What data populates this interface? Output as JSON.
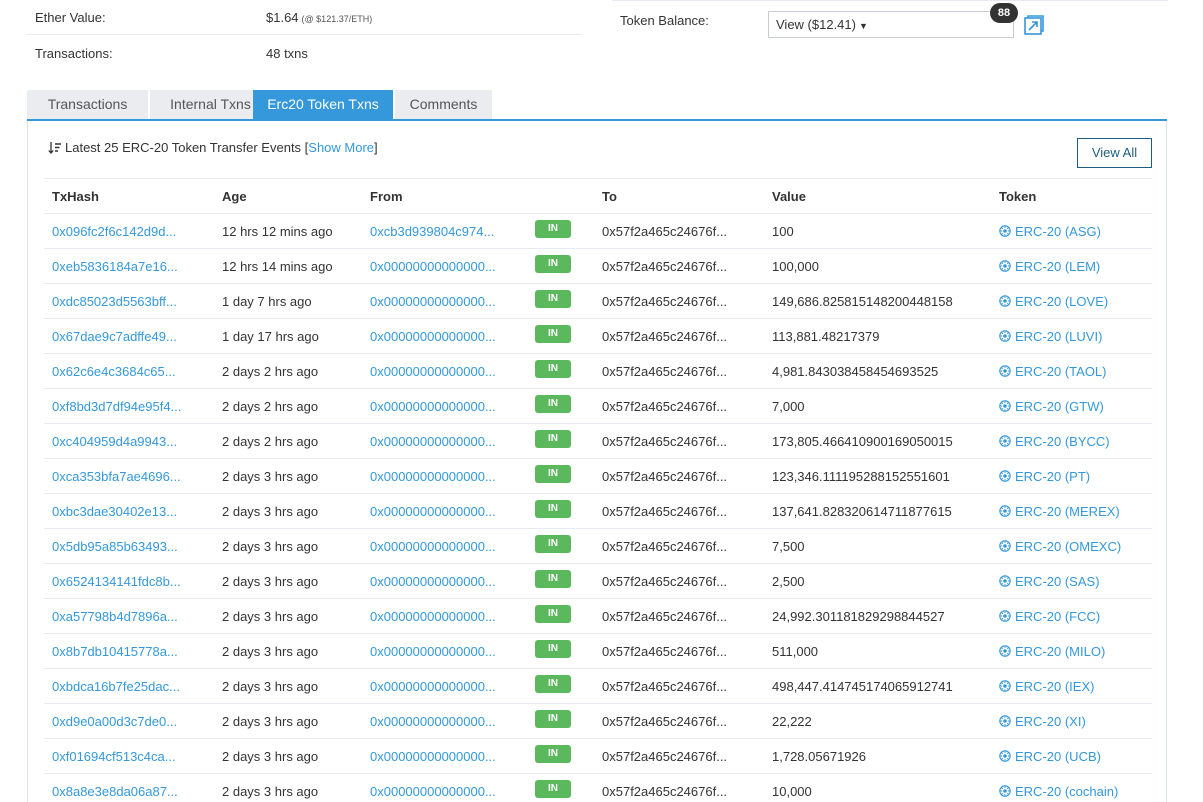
{
  "summary": {
    "ether_value_label": "Ether Value:",
    "ether_value": "$1.64",
    "ether_rate": "(@ $121.37/ETH)",
    "transactions_label": "Transactions:",
    "transactions_value": "48 txns",
    "token_balance_label": "Token Balance:",
    "token_balance_select": "View ($12.41)",
    "token_count_badge": "88"
  },
  "tabs": [
    {
      "label": "Transactions",
      "active": false
    },
    {
      "label": "Internal Txns",
      "active": false
    },
    {
      "label": "Erc20 Token Txns",
      "active": true
    },
    {
      "label": "Comments",
      "active": false
    }
  ],
  "panel": {
    "title_prefix": "Latest 25 ERC-20 Token Transfer Events [",
    "show_more": "Show More",
    "title_suffix": "]",
    "view_all": "View All"
  },
  "table": {
    "headers": [
      "TxHash",
      "Age",
      "From",
      "To",
      "Value",
      "Token"
    ],
    "direction_label": "IN",
    "rows": [
      {
        "hash": "0x096fc2f6c142d9d...",
        "age": "12 hrs 12 mins ago",
        "from": "0xcb3d939804c974...",
        "to": "0x57f2a465c24676f...",
        "value": "100",
        "token": "ERC-20 (ASG)"
      },
      {
        "hash": "0xeb5836184a7e16...",
        "age": "12 hrs 14 mins ago",
        "from": "0x00000000000000...",
        "to": "0x57f2a465c24676f...",
        "value": "100,000",
        "token": "ERC-20 (LEM)"
      },
      {
        "hash": "0xdc85023d5563bff...",
        "age": "1 day 7 hrs ago",
        "from": "0x00000000000000...",
        "to": "0x57f2a465c24676f...",
        "value": "149,686.825815148200448158",
        "token": "ERC-20 (LOVE)"
      },
      {
        "hash": "0x67dae9c7adffe49...",
        "age": "1 day 17 hrs ago",
        "from": "0x00000000000000...",
        "to": "0x57f2a465c24676f...",
        "value": "113,881.48217379",
        "token": "ERC-20 (LUVI)"
      },
      {
        "hash": "0x62c6e4c3684c65...",
        "age": "2 days 2 hrs ago",
        "from": "0x00000000000000...",
        "to": "0x57f2a465c24676f...",
        "value": "4,981.843038458454693525",
        "token": "ERC-20 (TAOL)"
      },
      {
        "hash": "0xf8bd3d7df94e95f4...",
        "age": "2 days 2 hrs ago",
        "from": "0x00000000000000...",
        "to": "0x57f2a465c24676f...",
        "value": "7,000",
        "token": "ERC-20 (GTW)"
      },
      {
        "hash": "0xc404959d4a9943...",
        "age": "2 days 2 hrs ago",
        "from": "0x00000000000000...",
        "to": "0x57f2a465c24676f...",
        "value": "173,805.466410900169050015",
        "token": "ERC-20 (BYCC)"
      },
      {
        "hash": "0xca353bfa7ae4696...",
        "age": "2 days 3 hrs ago",
        "from": "0x00000000000000...",
        "to": "0x57f2a465c24676f...",
        "value": "123,346.111195288152551601",
        "token": "ERC-20 (PT)"
      },
      {
        "hash": "0xbc3dae30402e13...",
        "age": "2 days 3 hrs ago",
        "from": "0x00000000000000...",
        "to": "0x57f2a465c24676f...",
        "value": "137,641.828320614711877615",
        "token": "ERC-20 (MEREX)"
      },
      {
        "hash": "0x5db95a85b63493...",
        "age": "2 days 3 hrs ago",
        "from": "0x00000000000000...",
        "to": "0x57f2a465c24676f...",
        "value": "7,500",
        "token": "ERC-20 (OMEXC)"
      },
      {
        "hash": "0x6524134141fdc8b...",
        "age": "2 days 3 hrs ago",
        "from": "0x00000000000000...",
        "to": "0x57f2a465c24676f...",
        "value": "2,500",
        "token": "ERC-20 (SAS)"
      },
      {
        "hash": "0xa57798b4d7896a...",
        "age": "2 days 3 hrs ago",
        "from": "0x00000000000000...",
        "to": "0x57f2a465c24676f...",
        "value": "24,992.301181829298844527",
        "token": "ERC-20 (FCC)"
      },
      {
        "hash": "0x8b7db10415778a...",
        "age": "2 days 3 hrs ago",
        "from": "0x00000000000000...",
        "to": "0x57f2a465c24676f...",
        "value": "511,000",
        "token": "ERC-20 (MILO)"
      },
      {
        "hash": "0xbdca16b7fe25dac...",
        "age": "2 days 3 hrs ago",
        "from": "0x00000000000000...",
        "to": "0x57f2a465c24676f...",
        "value": "498,447.414745174065912741",
        "token": "ERC-20 (IEX)"
      },
      {
        "hash": "0xd9e0a00d3c7de0...",
        "age": "2 days 3 hrs ago",
        "from": "0x00000000000000...",
        "to": "0x57f2a465c24676f...",
        "value": "22,222",
        "token": "ERC-20 (XI)"
      },
      {
        "hash": "0xf01694cf513c4ca...",
        "age": "2 days 3 hrs ago",
        "from": "0x00000000000000...",
        "to": "0x57f2a465c24676f...",
        "value": "1,728.05671926",
        "token": "ERC-20 (UCB)"
      },
      {
        "hash": "0x8a8e3e8da06a87...",
        "age": "2 days 3 hrs ago",
        "from": "0x00000000000000...",
        "to": "0x57f2a465c24676f...",
        "value": "10,000",
        "token": "ERC-20 (cochain)"
      }
    ]
  },
  "icons": {
    "sort": "sort-descending-icon",
    "token": "ethereum-token-icon",
    "expand": "expand-window-icon",
    "caret": "caret-down-icon"
  },
  "colors": {
    "link": "#3498db",
    "tab_active": "#3498db",
    "tab_inactive": "#eaecf0",
    "in_badge": "#5cb85c",
    "view_all_border": "#1e5d7e"
  }
}
